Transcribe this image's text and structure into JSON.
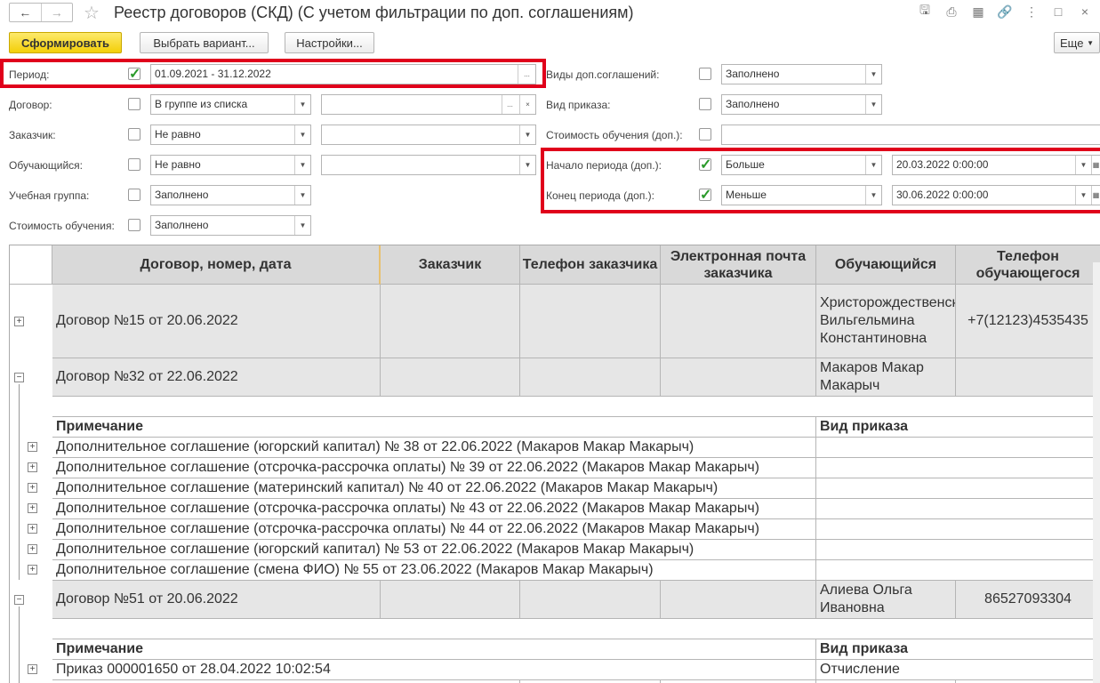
{
  "window": {
    "title": "Реестр договоров (СКД) (С учетом фильтрации по доп. соглашениям)"
  },
  "toolbar": {
    "generate": "Сформировать",
    "choose_variant": "Выбрать вариант...",
    "settings": "Настройки...",
    "more": "Еще"
  },
  "filters": {
    "period": {
      "label": "Период:",
      "checked": true,
      "value": "01.09.2021 - 31.12.2022",
      "button": "..."
    },
    "contract": {
      "label": "Договор:",
      "checked": false,
      "condition": "В группе из списка",
      "value": "",
      "button": "...",
      "clear": "×"
    },
    "customer": {
      "label": "Заказчик:",
      "checked": false,
      "condition": "Не равно",
      "value": ""
    },
    "student": {
      "label": "Обучающийся:",
      "checked": false,
      "condition": "Не равно",
      "value": ""
    },
    "group": {
      "label": "Учебная группа:",
      "checked": false,
      "condition": "Заполнено"
    },
    "cost": {
      "label": "Стоимость обучения:",
      "checked": false,
      "condition": "Заполнено"
    },
    "agreement_types": {
      "label": "Виды доп.соглашений:",
      "checked": false,
      "condition": "Заполнено"
    },
    "order_type": {
      "label": "Вид приказа:",
      "checked": false,
      "condition": "Заполнено"
    },
    "cost_add": {
      "label": "Стоимость обучения (доп.):",
      "checked": false,
      "value": ""
    },
    "start_add": {
      "label": "Начало периода (доп.):",
      "checked": true,
      "condition": "Больше",
      "value": "20.03.2022  0:00:00"
    },
    "end_add": {
      "label": "Конец периода (доп.):",
      "checked": true,
      "condition": "Меньше",
      "value": "30.06.2022  0:00:00"
    }
  },
  "table": {
    "headers": [
      "Договор, номер, дата",
      "Заказчик",
      "Телефон заказчика",
      "Электронная почта заказчика",
      "Обучающийся",
      "Телефон обучающегося"
    ],
    "contracts": [
      {
        "name": "Договор №15 от 20.06.2022",
        "student": "Христорождественская Вильгельмина Константиновна",
        "phone": "+7(12123)4535435"
      },
      {
        "name": "Договор №32 от 22.06.2022",
        "student": "Макаров Макар Макарыч",
        "phone": ""
      },
      {
        "name": "Договор №51 от 20.06.2022",
        "student": "Алиева Ольга Ивановна",
        "phone": "86527093304"
      }
    ],
    "sub_header": {
      "note": "Примечание",
      "order": "Вид приказа"
    },
    "agreements": [
      "Дополнительное соглашение (югорский капитал) № 38 от 22.06.2022 (Макаров Макар Макарыч)",
      "Дополнительное соглашение (отсрочка-рассрочка оплаты) № 39 от 22.06.2022 (Макаров Макар Макарыч)",
      "Дополнительное соглашение (материнский капитал) № 40 от 22.06.2022 (Макаров Макар Макарыч)",
      "Дополнительное соглашение (отсрочка-рассрочка оплаты) № 43 от 22.06.2022 (Макаров Макар Макарыч)",
      "Дополнительное соглашение (отсрочка-рассрочка оплаты) № 44 от 22.06.2022 (Макаров Макар Макарыч)",
      "Дополнительное соглашение (югорский капитал) № 53 от 22.06.2022 (Макаров Макар Макарыч)",
      "Дополнительное соглашение (смена ФИО) № 55 от 23.06.2022 (Макаров Макар Макарыч)"
    ],
    "orders": [
      {
        "note": "Приказ 000001650 от 28.04.2022 10:02:54",
        "type": "Отчисление"
      }
    ]
  },
  "colors": {
    "highlight": "#e0001b",
    "primary_button": "#f3cf08",
    "header_bg": "#d9d9d9",
    "row_bg": "#e6e6e6"
  }
}
